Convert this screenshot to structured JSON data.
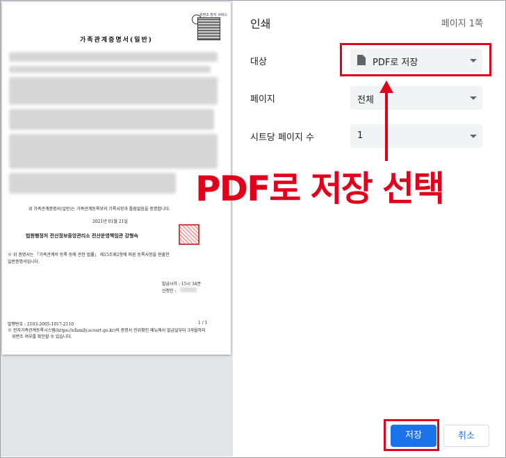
{
  "document": {
    "title": "가족관계증명서(일반)",
    "qr_label": "위변조 방지 서비스",
    "certify_text": "위 가족관계증명서(일반)는 가족관계등록부의 기록사항과 틀림없음을 증명합니다.",
    "date": "2021년 01월 21일",
    "issuer": "법원행정처 전산정보중앙관리소 전산운영책임관 강형숙",
    "notice_line1": "※ 위 증명서는 「가족관계의 등록 등에 관한 법률」 제15조제2항에 따른 등록사항을 현출한",
    "notice_line2": "일반증명서입니다.",
    "issue_time": "발급시각 : 15시 34분",
    "issuer_label": "신청인 :",
    "doc_number": "발행번호 : 2103-2005-1017-2110",
    "page_count": "1 / 1",
    "footer_line1": "※ 전자가족관계등록시스템(https://efamily.scourt.go.kr)의 증명서 진위확인 메뉴에서 발급일부터 3개월까지",
    "footer_line2": "위변조 여부를 확인할 수 있습니다."
  },
  "panel": {
    "title": "인쇄",
    "page_count": "페이지 1쪽",
    "destination_label": "대상",
    "destination_value": "PDF로 저장",
    "destination_icon": "file-icon",
    "pages_label": "페이지",
    "pages_value": "전체",
    "per_sheet_label": "시트당 페이지 수",
    "per_sheet_value": "1"
  },
  "annotation": {
    "text": "PDF로 저장 선택",
    "color": "#e0001b"
  },
  "buttons": {
    "save": "저장",
    "cancel": "취소"
  },
  "colors": {
    "accent": "#1a73e8",
    "highlight": "#e0001b",
    "select_bg": "#f1f3f4"
  }
}
